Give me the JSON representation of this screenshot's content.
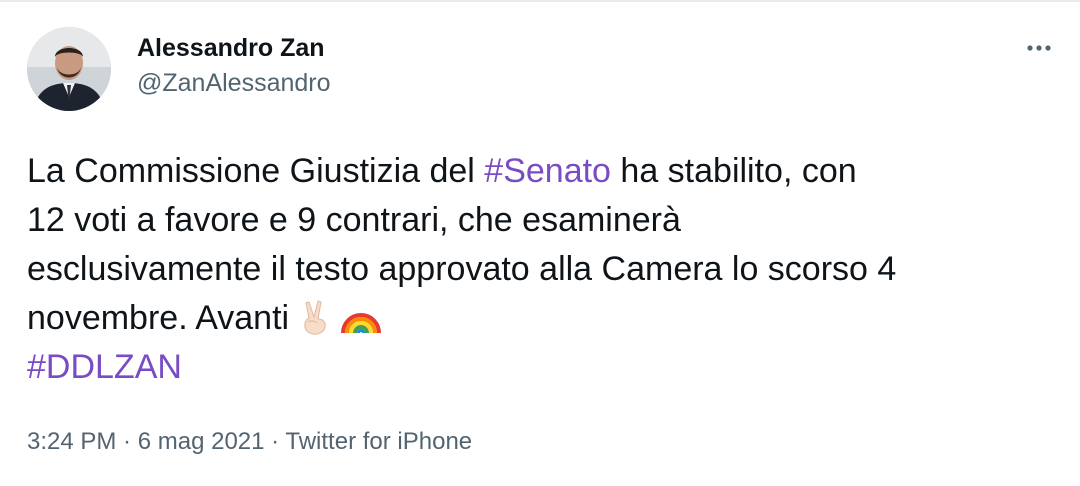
{
  "author": {
    "display_name": "Alessandro Zan",
    "handle": "@ZanAlessandro"
  },
  "tweet": {
    "line1_pre": "La Commissione Giustizia del ",
    "hashtag_senato": "#Senato",
    "line1_post": " ha stabilito, con",
    "line2": "12 voti a favore e 9 contrari, che esaminerà",
    "line3": "esclusivamente il testo approvato alla Camera lo scorso 4",
    "line4": "novembre. Avanti",
    "hashtag_ddlzan": "#DDLZAN"
  },
  "meta": {
    "time": "3:24 PM",
    "separator": " · ",
    "date": "6 mag 2021",
    "source": "Twitter for iPhone"
  },
  "colors": {
    "hashtag": "#794bc4",
    "secondary_text": "#536471",
    "primary_text": "#0f1419"
  },
  "icons": {
    "more": "more-horizontal-icon",
    "victory": "victory-hand-emoji",
    "rainbow": "rainbow-emoji"
  }
}
